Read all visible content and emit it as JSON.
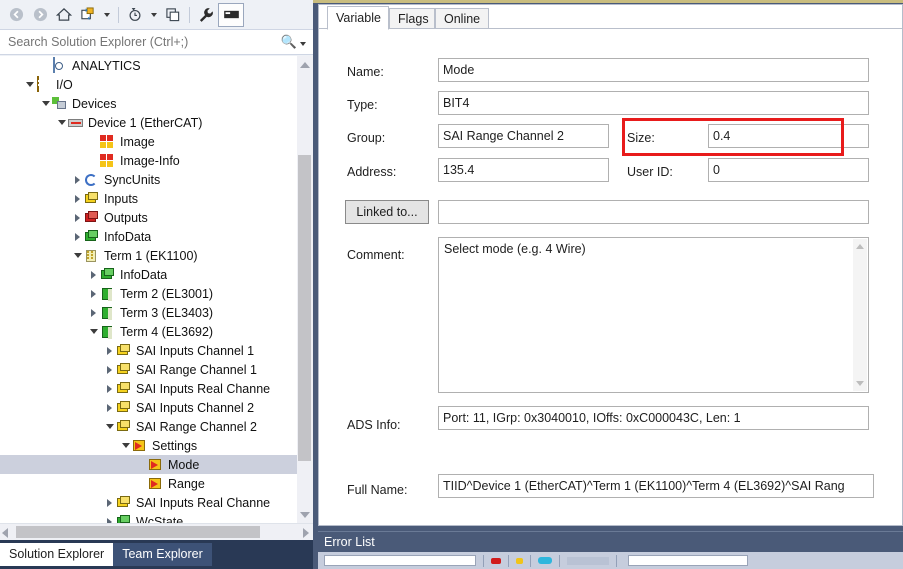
{
  "solution_explorer": {
    "toolbar": {
      "back": "back-icon",
      "forward": "forward-icon",
      "home": "home-icon",
      "sync_with_active_document": "sync-icon",
      "pending_changes_filter": "clock-filter-icon",
      "refresh": "refresh-icon",
      "properties": "wrench-icon",
      "show_all_files": "show-all-files-icon"
    },
    "search": {
      "placeholder": "Search Solution Explorer (Ctrl+;)",
      "value": ""
    },
    "tree": [
      {
        "label": "ANALYTICS",
        "indent": 2,
        "twisty": "none",
        "icon": "analytics"
      },
      {
        "label": "I/O",
        "indent": 1,
        "twisty": "down",
        "icon": "io"
      },
      {
        "label": "Devices",
        "indent": 2,
        "twisty": "down",
        "icon": "devices"
      },
      {
        "label": "Device 1 (EtherCAT)",
        "indent": 3,
        "twisty": "down",
        "icon": "ethercat"
      },
      {
        "label": "Image",
        "indent": 5,
        "twisty": "none",
        "icon": "image"
      },
      {
        "label": "Image-Info",
        "indent": 5,
        "twisty": "none",
        "icon": "image"
      },
      {
        "label": "SyncUnits",
        "indent": 4,
        "twisty": "right",
        "icon": "sync"
      },
      {
        "label": "Inputs",
        "indent": 4,
        "twisty": "right",
        "icon": "box-yellow"
      },
      {
        "label": "Outputs",
        "indent": 4,
        "twisty": "right",
        "icon": "box-red"
      },
      {
        "label": "InfoData",
        "indent": 4,
        "twisty": "right",
        "icon": "box-green"
      },
      {
        "label": "Term 1 (EK1100)",
        "indent": 4,
        "twisty": "down",
        "icon": "terminal"
      },
      {
        "label": "InfoData",
        "indent": 5,
        "twisty": "right",
        "icon": "box-green"
      },
      {
        "label": "Term 2 (EL3001)",
        "indent": 5,
        "twisty": "right",
        "icon": "terminal-green"
      },
      {
        "label": "Term 3 (EL3403)",
        "indent": 5,
        "twisty": "right",
        "icon": "terminal-green"
      },
      {
        "label": "Term 4 (EL3692)",
        "indent": 5,
        "twisty": "down",
        "icon": "terminal-green"
      },
      {
        "label": "SAI Inputs Channel 1",
        "indent": 6,
        "twisty": "right",
        "icon": "box-yellow"
      },
      {
        "label": "SAI Range Channel 1",
        "indent": 6,
        "twisty": "right",
        "icon": "box-yellow"
      },
      {
        "label": "SAI Inputs Real Channe",
        "indent": 6,
        "twisty": "right",
        "icon": "box-yellow"
      },
      {
        "label": "SAI Inputs Channel 2",
        "indent": 6,
        "twisty": "right",
        "icon": "box-yellow"
      },
      {
        "label": "SAI Range Channel 2",
        "indent": 6,
        "twisty": "down",
        "icon": "box-yellow"
      },
      {
        "label": "Settings",
        "indent": 7,
        "twisty": "down",
        "icon": "settings"
      },
      {
        "label": "Mode",
        "indent": 8,
        "twisty": "none",
        "icon": "variable",
        "selected": true
      },
      {
        "label": "Range",
        "indent": 8,
        "twisty": "none",
        "icon": "variable"
      },
      {
        "label": "SAI Inputs Real Channe",
        "indent": 6,
        "twisty": "right",
        "icon": "box-yellow"
      },
      {
        "label": "WcState",
        "indent": 6,
        "twisty": "right",
        "icon": "box-green"
      }
    ],
    "bottom_tabs": [
      {
        "label": "Solution Explorer",
        "active": true
      },
      {
        "label": "Team Explorer",
        "active": false
      }
    ]
  },
  "document": {
    "tabs": [
      {
        "label": "Variable",
        "active": true
      },
      {
        "label": "Flags",
        "active": false
      },
      {
        "label": "Online",
        "active": false
      }
    ],
    "fields": {
      "name_label": "Name:",
      "name_value": "Mode",
      "type_label": "Type:",
      "type_value": "BIT4",
      "group_label": "Group:",
      "group_value": "SAI Range Channel 2",
      "size_label": "Size:",
      "size_value": "0.4",
      "address_label": "Address:",
      "address_value": "135.4",
      "userid_label": "User ID:",
      "userid_value": "0",
      "linked_to_label": "Linked to...",
      "linked_to_value": "",
      "comment_label": "Comment:",
      "comment_value": "Select mode (e.g. 4 Wire)",
      "ads_info_label": "ADS Info:",
      "ads_info_value": "Port: 11, IGrp: 0x3040010, IOffs: 0xC000043C, Len: 1",
      "full_name_label": "Full Name:",
      "full_name_value": "TIID^Device 1 (EtherCAT)^Term 1 (EK1100)^Term 4 (EL3692)^SAI Rang"
    },
    "highlight_color": "#e81b1b"
  },
  "error_list": {
    "title": "Error List",
    "search_value": "",
    "filters": [
      "errors-icon",
      "warnings-icon",
      "messages-icon"
    ]
  }
}
